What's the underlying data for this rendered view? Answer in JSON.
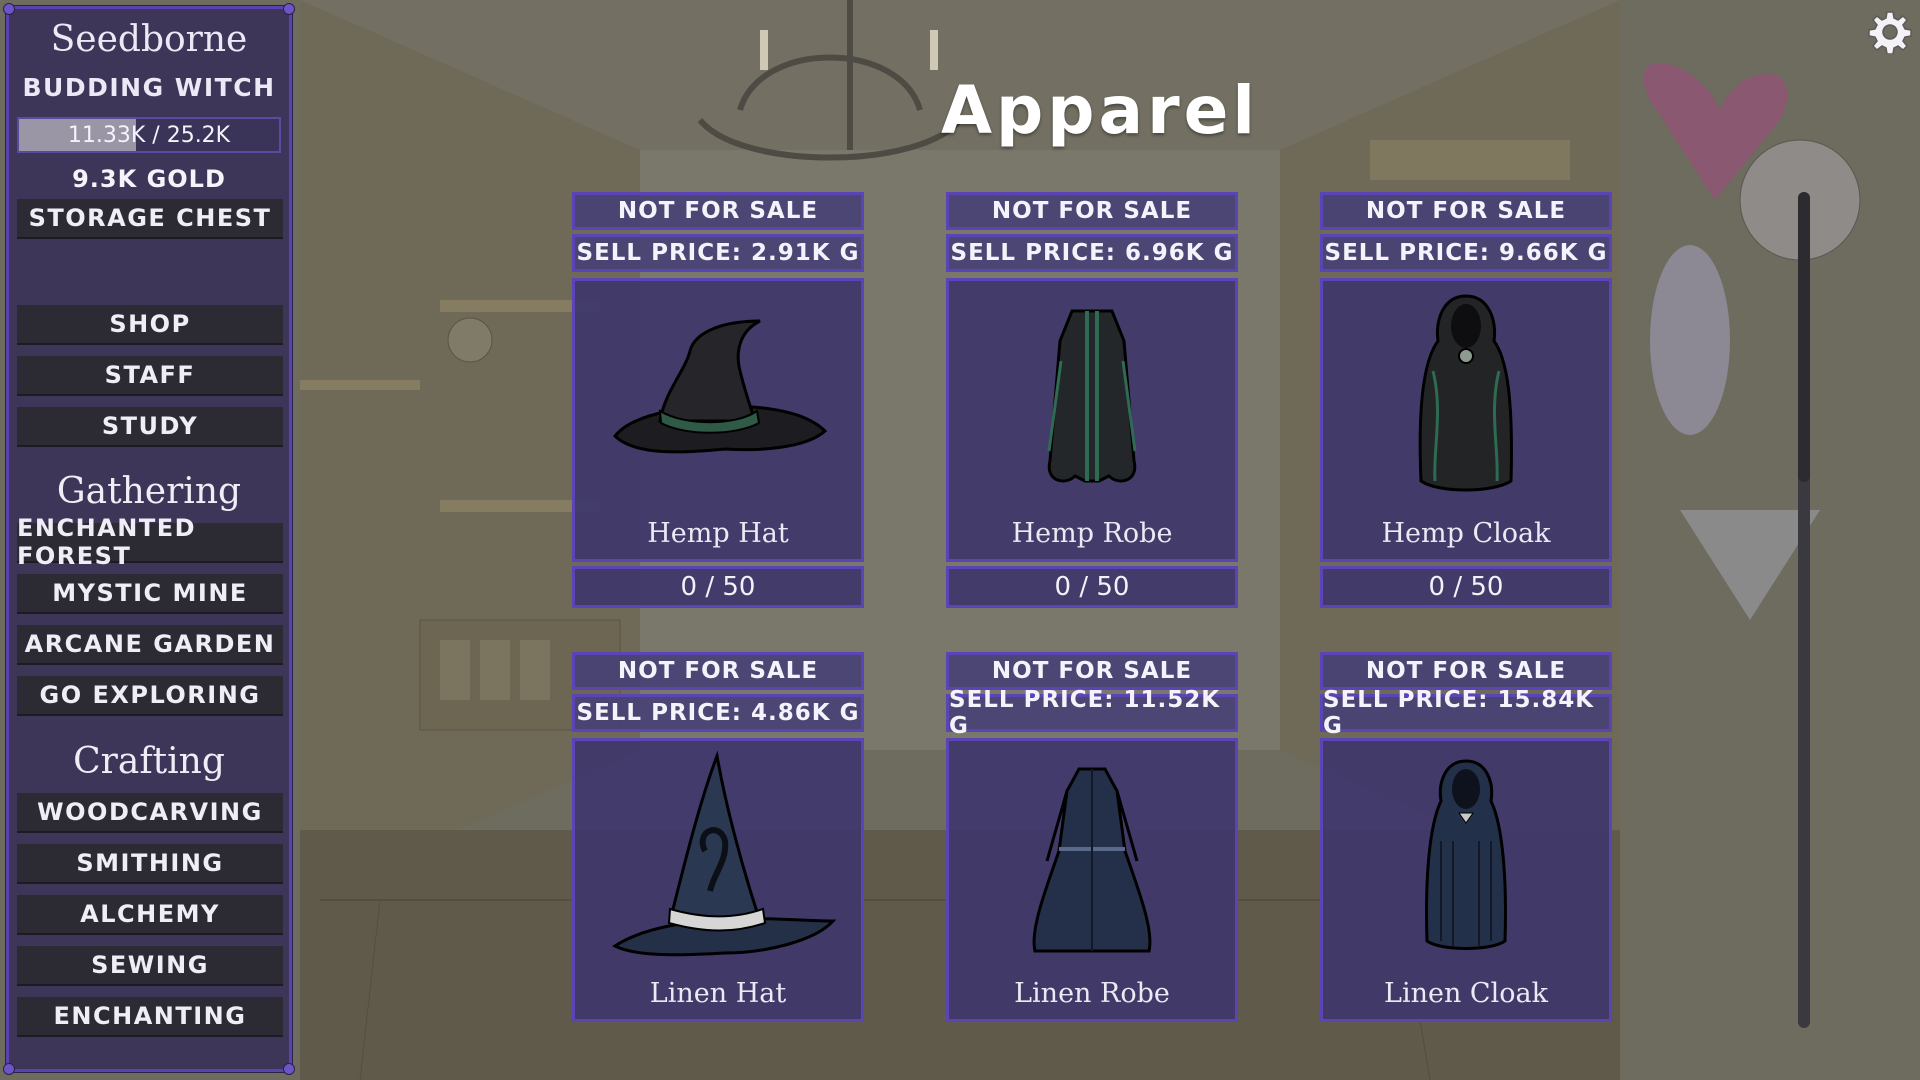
{
  "player": {
    "name": "Seedborne",
    "rank": "BUDDING WITCH",
    "xp_text": "11.33K / 25.2K",
    "xp_fraction": 0.45,
    "gold": "9.3K GOLD"
  },
  "sidebar": {
    "storage": "STORAGE CHEST",
    "main": [
      "SHOP",
      "STAFF",
      "STUDY"
    ],
    "gathering_label": "Gathering",
    "gathering": [
      "ENCHANTED FOREST",
      "MYSTIC MINE",
      "ARCANE GARDEN",
      "GO EXPLORING"
    ],
    "crafting_label": "Crafting",
    "crafting": [
      "WOODCARVING",
      "SMITHING",
      "ALCHEMY",
      "SEWING",
      "ENCHANTING"
    ]
  },
  "page": {
    "title": "Apparel"
  },
  "items": [
    {
      "status": "NOT FOR SALE",
      "price": "SELL PRICE: 2.91K G",
      "name": "Hemp Hat",
      "qty": "0 / 50",
      "icon": "witch-hat-black-icon"
    },
    {
      "status": "NOT FOR SALE",
      "price": "SELL PRICE: 6.96K G",
      "name": "Hemp Robe",
      "qty": "0 / 50",
      "icon": "robe-green-icon"
    },
    {
      "status": "NOT FOR SALE",
      "price": "SELL PRICE: 9.66K G",
      "name": "Hemp Cloak",
      "qty": "0 / 50",
      "icon": "hooded-cloak-green-icon"
    },
    {
      "status": "NOT FOR SALE",
      "price": "SELL PRICE: 4.86K G",
      "name": "Linen Hat",
      "icon": "witch-hat-blue-icon"
    },
    {
      "status": "NOT FOR SALE",
      "price": "SELL PRICE: 11.52K G",
      "name": "Linen Robe",
      "icon": "gown-blue-icon"
    },
    {
      "status": "NOT FOR SALE",
      "price": "SELL PRICE: 15.84K G",
      "name": "Linen Cloak",
      "icon": "hooded-cloak-blue-icon"
    }
  ],
  "colors": {
    "panel": "#3e386c",
    "border": "#5a44b6",
    "button": "#2c2a33"
  },
  "icons": {
    "settings": "gear-icon"
  }
}
